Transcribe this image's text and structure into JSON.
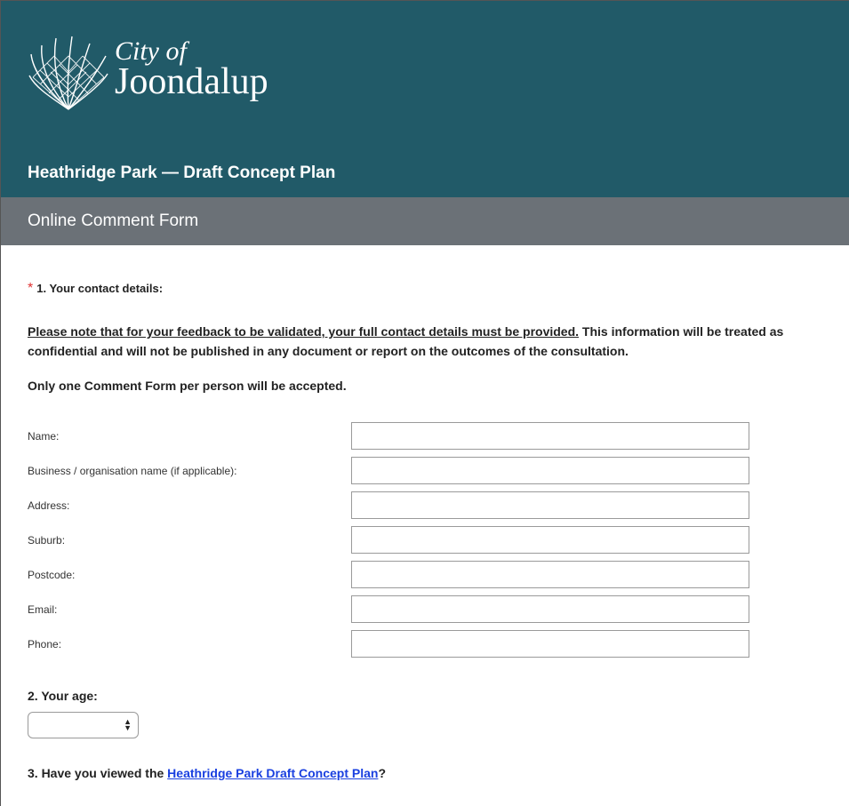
{
  "header": {
    "logo_line1": "City of",
    "logo_line2": "Joondalup",
    "survey_title": "Heathridge Park — Draft Concept Plan",
    "form_subtitle": "Online Comment Form"
  },
  "question1": {
    "required_mark": "*",
    "heading": "1. Your contact details:",
    "notice_underlined": "Please note that for your feedback to be validated, your full contact details must be provided.",
    "notice_rest": " This information will be treated as confidential and will not be published in any document or report on the outcomes of the consultation.",
    "only_one": "Only one Comment Form per person will be accepted.",
    "fields": [
      {
        "label": "Name:",
        "value": ""
      },
      {
        "label": "Business / organisation name (if applicable):",
        "value": ""
      },
      {
        "label": "Address:",
        "value": ""
      },
      {
        "label": "Suburb:",
        "value": ""
      },
      {
        "label": "Postcode:",
        "value": ""
      },
      {
        "label": "Email:",
        "value": ""
      },
      {
        "label": "Phone:",
        "value": ""
      }
    ]
  },
  "question2": {
    "heading": "2. Your age:",
    "selected_value": ""
  },
  "question3": {
    "heading_prefix": "3. Have you viewed the ",
    "link_text": "Heathridge Park Draft Concept Plan",
    "heading_suffix": "?"
  },
  "colors": {
    "brand_bar": "#215a68",
    "subtitle_bar": "#6b7177",
    "required": "#e03030",
    "link": "#1a40e0"
  },
  "icons": {
    "logo": "joondalup-logo-icon",
    "select_arrows": "updown-arrows-icon"
  }
}
